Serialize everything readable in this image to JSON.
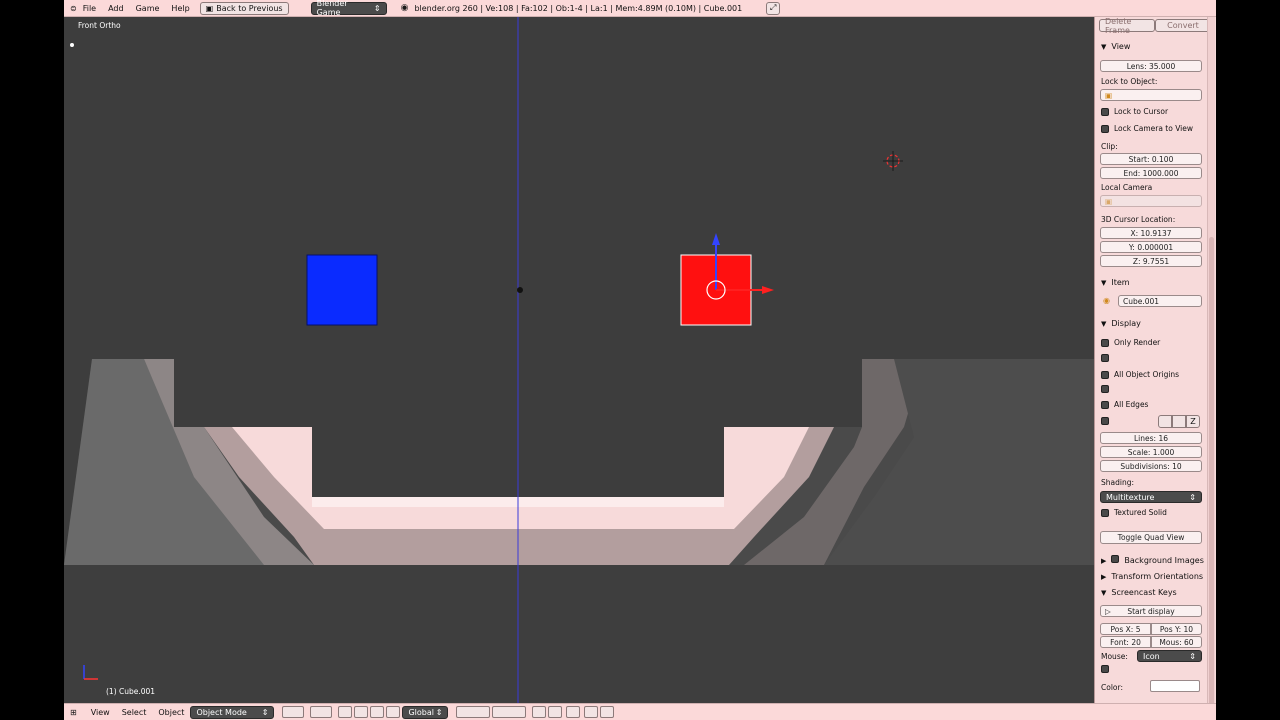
{
  "topbar": {
    "menu": [
      "File",
      "Add",
      "Game",
      "Help"
    ],
    "back_button": "Back to Previous",
    "engine": "Blender Game",
    "stats": "blender.org 260 | Ve:108 | Fa:102 | Ob:1-4 | La:1 | Mem:4.89M (0.10M) | Cube.001"
  },
  "viewport": {
    "view_label": "Front Ortho",
    "object_label": "(1) Cube.001"
  },
  "panel": {
    "tabs": [
      "Delete Frame",
      "Convert"
    ],
    "view": {
      "title": "View",
      "lens": "Lens: 35.000",
      "lock_to_object": "Lock to Object:",
      "lock_to_cursor": "Lock to Cursor",
      "lock_camera_to_view": "Lock Camera to View",
      "clip": "Clip:",
      "clip_start": "Start: 0.100",
      "clip_end": "End: 1000.000",
      "local_camera": "Local Camera",
      "cursor_location": "3D Cursor Location:",
      "cursor_x": "X: 10.9137",
      "cursor_y": "Y: 0.000001",
      "cursor_z": "Z: 9.7551"
    },
    "item": {
      "title": "Item",
      "name": "Cube.001"
    },
    "display": {
      "title": "Display",
      "only_render": "Only Render",
      "all_object_origins": "All Object Origins",
      "all_edges": "All Edges",
      "axis_z": "Z",
      "lines": "Lines: 16",
      "scale": "Scale: 1.000",
      "subdivisions": "Subdivisions: 10",
      "shading_label": "Shading:",
      "shading_value": "Multitexture",
      "textured_solid": "Textured Solid",
      "toggle_quad_view": "Toggle Quad View"
    },
    "collapsed": {
      "background_images": "Background Images",
      "transform_orientations": "Transform Orientations"
    },
    "screencast": {
      "title": "Screencast Keys",
      "start_display": "Start display",
      "pos_x": "Pos X: 5",
      "pos_y": "Pos Y: 10",
      "font": "Font: 20",
      "mouse_size": "Mous: 60",
      "mouse_label": "Mouse:",
      "mouse_value": "Icon",
      "color_label": "Color:"
    }
  },
  "bottombar": {
    "menu": [
      "View",
      "Select",
      "Object"
    ],
    "mode": "Object Mode",
    "orientation": "Global"
  },
  "colors": {
    "viewport_bg": "#3d3d3d",
    "blue_cube": "#0a2bff",
    "red_cube": "#ff1010",
    "axis_line": "#3b3bd8",
    "ui_pink": "#f7dada"
  }
}
